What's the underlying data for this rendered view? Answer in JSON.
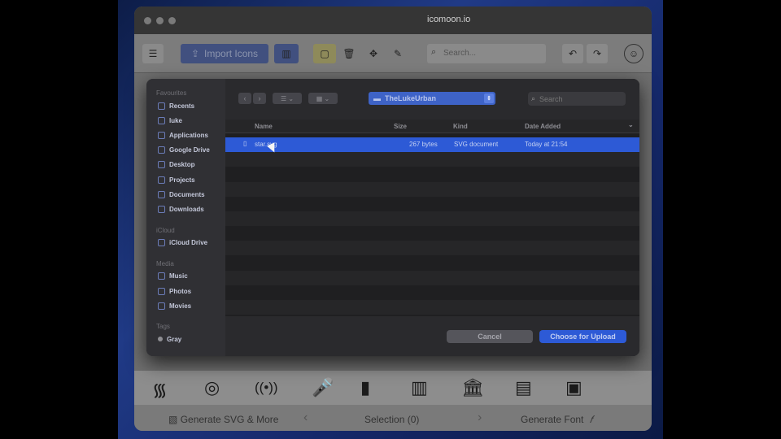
{
  "browser": {
    "url": "icomoon.io"
  },
  "toolbar": {
    "import_label": "Import Icons",
    "search_placeholder": "Search..."
  },
  "bottom": {
    "generate_svg": "Generate SVG & More",
    "selection": "Selection (0)",
    "generate_font": "Generate Font"
  },
  "dialog": {
    "sidebar": {
      "favourites_head": "Favourites",
      "favourites": [
        {
          "label": "Recents",
          "icon": "clock-icon"
        },
        {
          "label": "luke",
          "icon": "home-icon"
        },
        {
          "label": "Applications",
          "icon": "apps-icon"
        },
        {
          "label": "Google Drive",
          "icon": "drive-icon"
        },
        {
          "label": "Desktop",
          "icon": "desktop-icon"
        },
        {
          "label": "Projects",
          "icon": "folder-icon"
        },
        {
          "label": "Documents",
          "icon": "document-icon"
        },
        {
          "label": "Downloads",
          "icon": "download-icon"
        }
      ],
      "icloud_head": "iCloud",
      "icloud": [
        {
          "label": "iCloud Drive",
          "icon": "cloud-icon"
        }
      ],
      "media_head": "Media",
      "media": [
        {
          "label": "Music",
          "icon": "music-icon"
        },
        {
          "label": "Photos",
          "icon": "photos-icon"
        },
        {
          "label": "Movies",
          "icon": "movies-icon"
        }
      ],
      "tags_head": "Tags",
      "tags": [
        {
          "label": "Gray",
          "color": "#8e8e93"
        }
      ]
    },
    "path": "TheLukeUrban",
    "search_placeholder": "Search",
    "columns": {
      "name": "Name",
      "size": "Size",
      "kind": "Kind",
      "date": "Date Added"
    },
    "files": [
      {
        "name": "star.svg",
        "size": "267 bytes",
        "kind": "SVG document",
        "date": "Today at 21:54",
        "selected": true
      }
    ],
    "cancel": "Cancel",
    "choose": "Choose for Upload"
  }
}
